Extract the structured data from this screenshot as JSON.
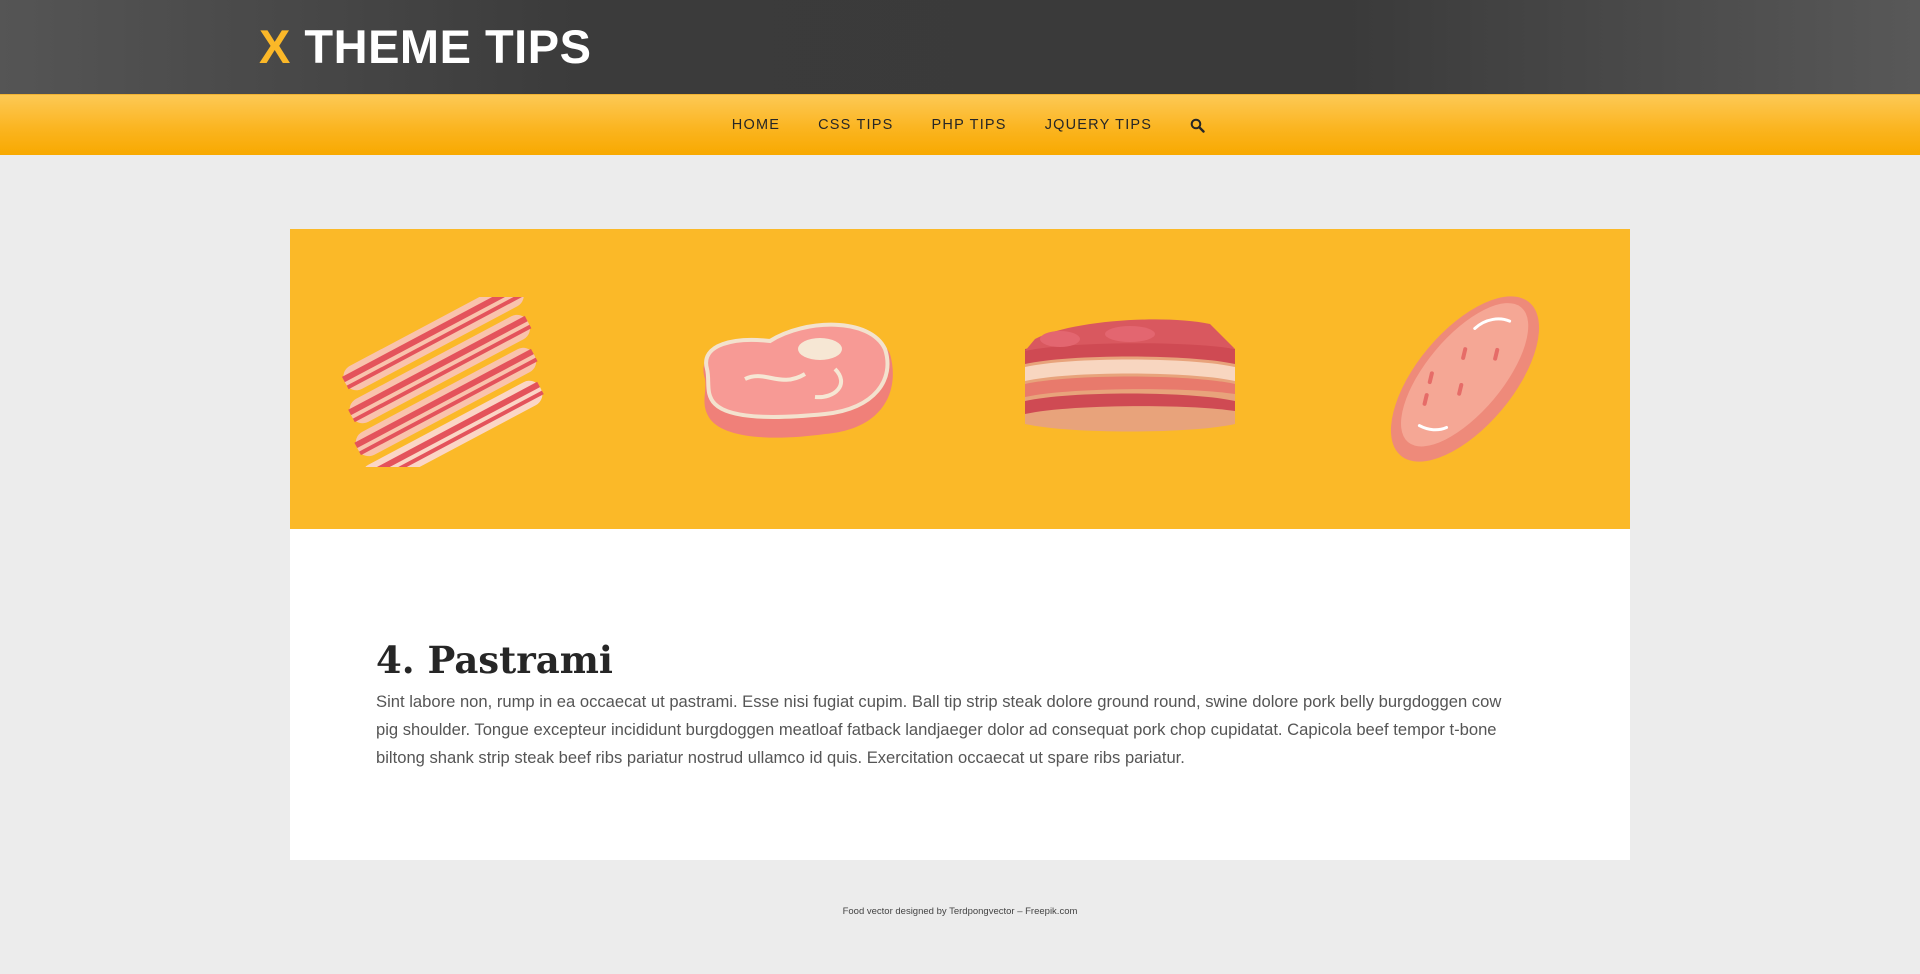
{
  "header": {
    "brand_x": "X",
    "brand_rest": " THEME TIPS"
  },
  "nav": {
    "items": [
      {
        "label": "HOME"
      },
      {
        "label": "CSS TIPS"
      },
      {
        "label": "PHP TIPS"
      },
      {
        "label": "JQUERY TIPS"
      }
    ],
    "search_icon": "search-icon"
  },
  "hero": {
    "background_color": "#fbb928",
    "illustrations": [
      "bacon-strips",
      "steak",
      "pork-belly",
      "sausage"
    ]
  },
  "post": {
    "title": "4. Pastrami",
    "body": "Sint labore non, rump in ea occaecat ut pastrami. Esse nisi fugiat cupim. Ball tip strip steak dolore ground round, swine dolore pork belly burgdoggen cow pig shoulder. Tongue excepteur incididunt burgdoggen meatloaf fatback landjaeger dolor ad consequat pork chop cupidatat. Capicola beef tempor t-bone biltong shank strip steak beef ribs pariatur nostrud ullamco id quis. Exercitation occaecat ut spare ribs pariatur."
  },
  "footer": {
    "credit": "Food vector designed by Terdpongvector – Freepik.com"
  },
  "colors": {
    "accent": "#fbb828",
    "topbar": "#3b3b3b",
    "page_bg": "#ececec"
  }
}
